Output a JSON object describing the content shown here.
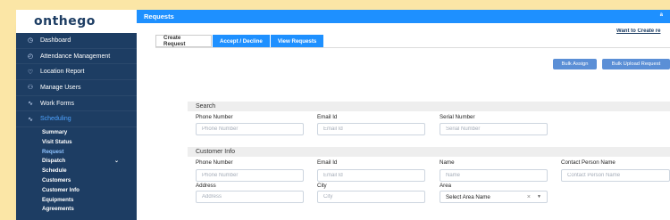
{
  "app": {
    "logo": "onthego",
    "header_title": "Requests",
    "header_corner": "a",
    "top_link": "Want to Create re"
  },
  "sidebar": {
    "items": [
      {
        "label": "Dashboard",
        "icon": "dashboard-icon",
        "glyph": "◷"
      },
      {
        "label": "Attendance Management",
        "icon": "clock-icon",
        "glyph": "◴"
      },
      {
        "label": "Location Report",
        "icon": "location-icon",
        "glyph": "♡"
      },
      {
        "label": "Manage Users",
        "icon": "user-icon",
        "glyph": "⚇"
      },
      {
        "label": "Work Forms",
        "icon": "chart-line-icon",
        "glyph": "∿"
      },
      {
        "label": "Scheduling",
        "icon": "chart-line-icon",
        "glyph": "∿"
      }
    ],
    "sub_items": [
      {
        "label": "Summary"
      },
      {
        "label": "Visit Status"
      },
      {
        "label": "Request"
      },
      {
        "label": "Dispatch"
      },
      {
        "label": "Schedule"
      },
      {
        "label": "Customers"
      },
      {
        "label": "Customer Info"
      },
      {
        "label": "Equipments"
      },
      {
        "label": "Agreements"
      }
    ]
  },
  "tabs": [
    "Create Request",
    "Accept / Decline",
    "View Requests"
  ],
  "buttons": {
    "bulk_assign": "Bulk Assign",
    "bulk_upload": "Bulk Upload Request"
  },
  "search": {
    "section_title": "Search",
    "phone_label": "Phone Number",
    "phone_placeholder": "Phone Number",
    "email_label": "Email Id",
    "email_placeholder": "Email Id",
    "serial_label": "Serial Number",
    "serial_placeholder": "Serial Number"
  },
  "customer": {
    "section_title": "Customer Info",
    "phone_label": "Phone Number",
    "phone_placeholder": "Phone Number",
    "email_label": "Email Id",
    "email_placeholder": "Email Id",
    "name_label": "Name",
    "name_placeholder": "Name",
    "contact_label": "Contact Person Name",
    "contact_placeholder": "Contact Person Name",
    "address_label": "Address",
    "address_placeholder": "Address",
    "city_label": "City",
    "city_placeholder": "City",
    "area_label": "Area",
    "area_value": "Select Area Name"
  },
  "colors": {
    "accent": "#1e90ff",
    "sidebar": "#1d3d63",
    "background": "#fbe6a6"
  }
}
